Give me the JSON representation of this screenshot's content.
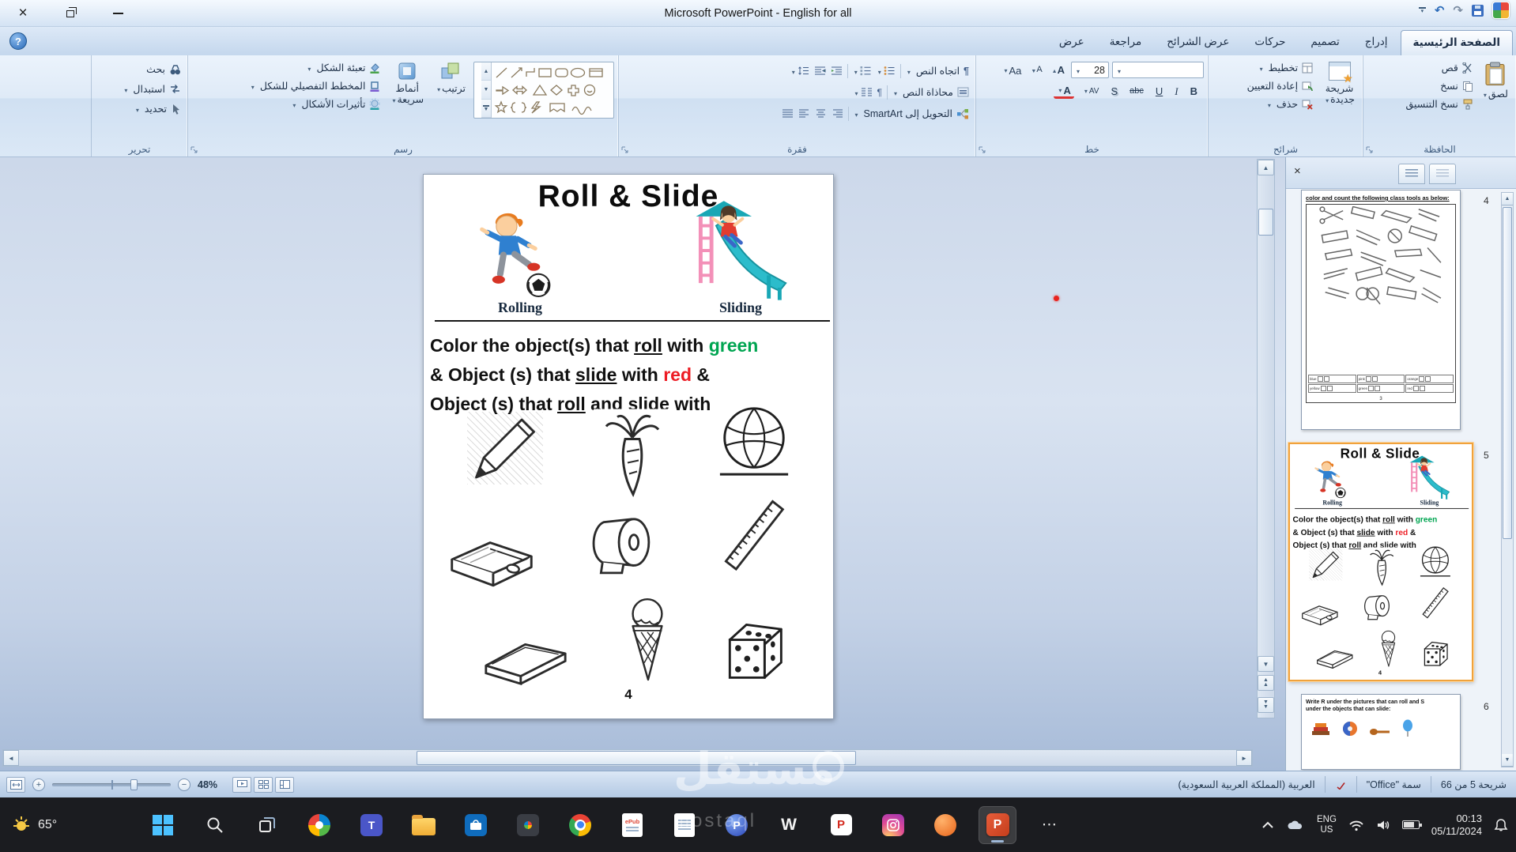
{
  "titlebar": {
    "title": "Microsoft PowerPoint - English for all"
  },
  "icons": {
    "close": "×",
    "help": "?",
    "undo": "↶",
    "redo": "↷",
    "star": "★",
    "up": "▲",
    "down": "▼",
    "left": "◄",
    "right": "►",
    "more_dots": "⋯",
    "zoom_in": "+",
    "zoom_out": "−",
    "pilcrow": "¶"
  },
  "ribbon_tabs": {
    "home": "الصفحة الرئيسية",
    "insert": "إدراج",
    "design": "تصميم",
    "animations": "حركات",
    "slide_show": "عرض الشرائح",
    "review": "مراجعة",
    "view": "عرض"
  },
  "clipboard_group": {
    "label": "الحافظة",
    "paste": "لصق",
    "cut": "قص",
    "copy": "نسخ",
    "format_painter": "نسخ التنسيق"
  },
  "slides_group": {
    "label": "شرائح",
    "new_slide_1": "شريحة",
    "new_slide_2": "جديدة",
    "layout": "تخطيط",
    "reset": "إعادة التعيين",
    "delete": "حذف"
  },
  "font_group": {
    "label": "خط",
    "font_size": "28",
    "bold": "B",
    "italic": "I",
    "underline": "U",
    "strike": "abc",
    "shadow": "S",
    "spacing": "AV",
    "case": "Aa",
    "color": "A",
    "grow": "A",
    "shrink": "A"
  },
  "paragraph_group": {
    "label": "فقرة",
    "text_direction": "اتجاه النص",
    "align_text": "محاذاة النص",
    "smartart": "التحويل إلى SmartArt"
  },
  "drawing_group": {
    "label": "رسم",
    "arrange": "ترتيب",
    "quick_styles_1": "أنماط",
    "quick_styles_2": "سريعة",
    "shape_fill": "تعبئة الشكل",
    "shape_outline": "المخطط التفصيلي للشكل",
    "shape_effects": "تأثيرات الأشكال"
  },
  "editing_group": {
    "label": "تحرير",
    "find": "بحث",
    "replace": "استبدال",
    "select": "تحديد"
  },
  "slide": {
    "title": "Roll & Slide",
    "rolling": "Rolling",
    "sliding": "Sliding",
    "line1_a": "Color the object(s) that ",
    "line1_roll": "roll",
    "line1_b": " with ",
    "line1_green": "green",
    "line2_a": "& Object (s) that ",
    "line2_slide": "slide",
    "line2_b": " with ",
    "line2_red": "red",
    "line2_c": "  &",
    "line3_a": "Object (s) that ",
    "line3_roll": "roll",
    "line3_b": " and ",
    "line3_slide": "slide",
    "line3_c": " with",
    "page_number": "4"
  },
  "thumbnails": {
    "slide4": {
      "number": "4",
      "title": "color and count the following class tools as below:",
      "footer": "3",
      "color_labels": [
        "blue",
        "pink",
        "orange",
        "yellow",
        "green",
        "red"
      ]
    },
    "slide5": {
      "number": "5"
    },
    "slide6": {
      "number": "6",
      "line1": "Write R under the pictures that can roll and S",
      "line2": "under the objects that can slide:"
    }
  },
  "statusbar": {
    "slide_counter": "شريحة 5 من 66",
    "theme": "سمة \"Office\"",
    "language": "العربية (المملكة العربية السعودية)",
    "zoom": "48%"
  },
  "taskbar": {
    "weather_temp": "65°",
    "epub_label": "ePub",
    "w_label": "W",
    "p_red_label": "P",
    "p_blue_label": "P",
    "teams_letter": "T",
    "ppt_label": "P",
    "lang_top": "ENG",
    "lang_bottom": "US",
    "time": "00:13",
    "date": "05/11/2024"
  },
  "watermark": {
    "text": "مستقل",
    "subtext": "mostaql"
  }
}
